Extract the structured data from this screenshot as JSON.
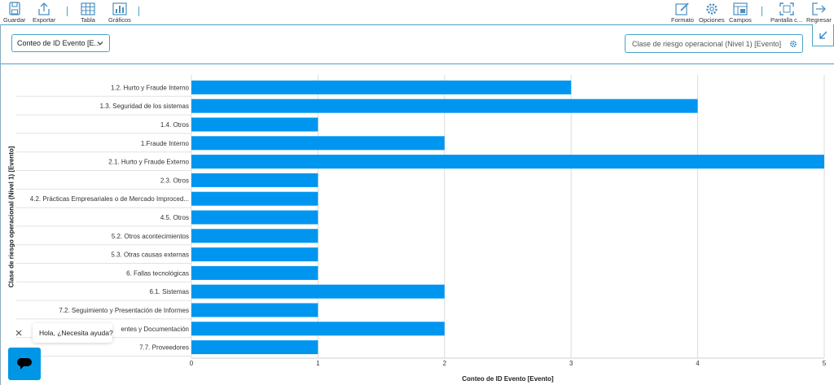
{
  "toolbar": {
    "guardar": "Guardar",
    "exportar": "Exportar",
    "tabla": "Tabla",
    "graficos": "Gráficos",
    "formato": "Formato",
    "opciones": "Opciones",
    "campos": "Campos",
    "pantalla": "Pantalla c...",
    "regresar": "Regresar"
  },
  "controls": {
    "measure_dropdown": "Conteo de ID Evento [E...",
    "dimension_dropdown": "Clase de riesgo operacional (Nivel 1) [Evento]"
  },
  "chat": {
    "message": "Hola, ¿Necesita ayuda?"
  },
  "colors": {
    "bar": "#0096f0",
    "accent": "#4aa3c8"
  },
  "chart_data": {
    "type": "bar",
    "orientation": "horizontal",
    "xlabel": "Conteo de ID Evento [Evento]",
    "ylabel": "Clase de riesgo operacional (Nivel 1) [Evento]",
    "xlim": [
      0,
      5
    ],
    "xticks": [
      "0",
      "1",
      "2",
      "3",
      "4",
      "5"
    ],
    "grid": true,
    "categories": [
      "1.2. Hurto y Fraude Interno",
      "1.3. Seguridad de los sistemas",
      "1.4. Otros",
      "1.Fraude Interno",
      "2.1. Hurto y Fraude Externo",
      "2.3. Otros",
      "4.2. Prácticas Empresariales o de Mercado Improced...",
      "4.5. Otros",
      "5.2. Otros acontecimientos",
      "5.3. Otras causas externas",
      "6. Fallas tecnológicas",
      "6.1. Sistemas",
      "7.2. Seguimiento y Presentación de Informes",
      "entes y Documentación",
      "7.7. Proveedores"
    ],
    "values": [
      3,
      4,
      1,
      2,
      5,
      1,
      1,
      1,
      1,
      1,
      1,
      2,
      1,
      2,
      1
    ]
  }
}
